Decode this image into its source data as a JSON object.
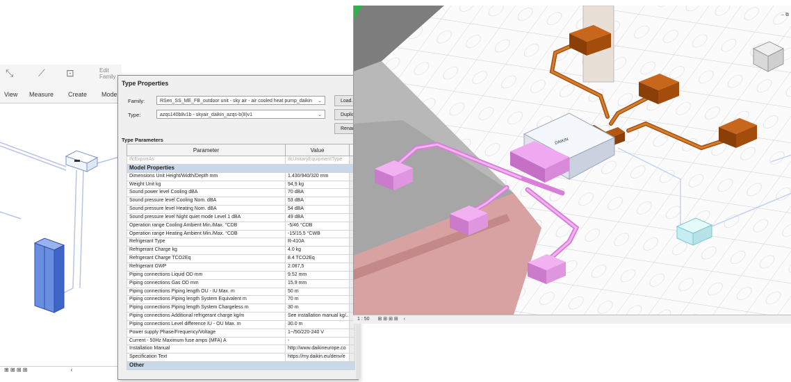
{
  "ribbon": {
    "items": [
      "View",
      "Measure",
      "Create",
      "Mode"
    ],
    "icons": [
      "modify-icon",
      "measure-icon",
      "create-icon",
      "edit-family-icon"
    ],
    "edit_family": "Edit Family"
  },
  "dialog": {
    "title": "Type Properties",
    "family_label": "Family:",
    "family_value": "RSen_SS_ME_FB_outdoor unit - sky air - air cooled heat pump_daikin",
    "type_label": "Type:",
    "type_value": "azqs140b8v1b - skyair_daikin_azqs-b(8)v1",
    "buttons": [
      "Load...",
      "Duplicate...",
      "Rename..."
    ],
    "type_parameters_label": "Type Parameters",
    "columns": [
      "Parameter",
      "Value"
    ],
    "ghost_row": {
      "param": "IfcExportAs",
      "value": "IfcUnitaryEquipmentType"
    },
    "group_model": "Model Properties",
    "rows": [
      {
        "param": "Dimensions Unit Height/Width/Depth mm",
        "value": "1.430/940/320 mm"
      },
      {
        "param": "Weight Unit kg",
        "value": "94,9 kg"
      },
      {
        "param": "Sound power level Cooling dBA",
        "value": "70 dBA"
      },
      {
        "param": "Sound pressure level Cooling Nom. dBA",
        "value": "53 dBA"
      },
      {
        "param": "Sound pressure level Heating Nom. dBA",
        "value": "54 dBA"
      },
      {
        "param": "Sound pressure level Night quiet mode Level 1 dBA",
        "value": "49 dBA"
      },
      {
        "param": "Operation range Cooling Ambient Min./Max. °CDB",
        "value": "-5/46 °CDB"
      },
      {
        "param": "Operation range Heating Ambient Min./Max. °CDB",
        "value": "-15/15.5 °CWB"
      },
      {
        "param": "Refrigerant Type",
        "value": "R-410A"
      },
      {
        "param": "Refrigerant Charge kg",
        "value": "4.0 kg"
      },
      {
        "param": "Refrigerant Charge TCO2Eq",
        "value": "8.4 TCO2Eq"
      },
      {
        "param": "Refrigerant GWP",
        "value": "2.087,5"
      },
      {
        "param": "Piping connections Liquid OD mm",
        "value": "9.52 mm"
      },
      {
        "param": "Piping connections Gas OD mm",
        "value": "15.9 mm"
      },
      {
        "param": "Piping connections Piping length OU - IU Max. m",
        "value": "50 m"
      },
      {
        "param": "Piping connections Piping length System Equivalent m",
        "value": "70 m"
      },
      {
        "param": "Piping connections Piping length System Chargeless m",
        "value": "30 m"
      },
      {
        "param": "Piping connections Additional refrigerant charge kg/m",
        "value": "See installation manual kg/..."
      },
      {
        "param": "Piping connections Level difference IU - OU Max. m",
        "value": "30.0 m"
      },
      {
        "param": "Power supply Phase/Frequency/Voltage",
        "value": "1~/50/220-240 V"
      },
      {
        "param": "Current - 50Hz Maximum fuse amps (MFA) A",
        "value": "-"
      },
      {
        "param": "Installation Manual",
        "value": "http://www.daikineurope.co"
      },
      {
        "param": "Specification Text",
        "value": "https://my.daikin.eu/denv/e"
      }
    ],
    "group_other": "Other"
  },
  "view3d": {
    "scale": "1 : 50",
    "outdoor_unit_logo": "DAIKIN"
  },
  "left_status": "⊞ ⊞ ⊞ ⊞"
}
